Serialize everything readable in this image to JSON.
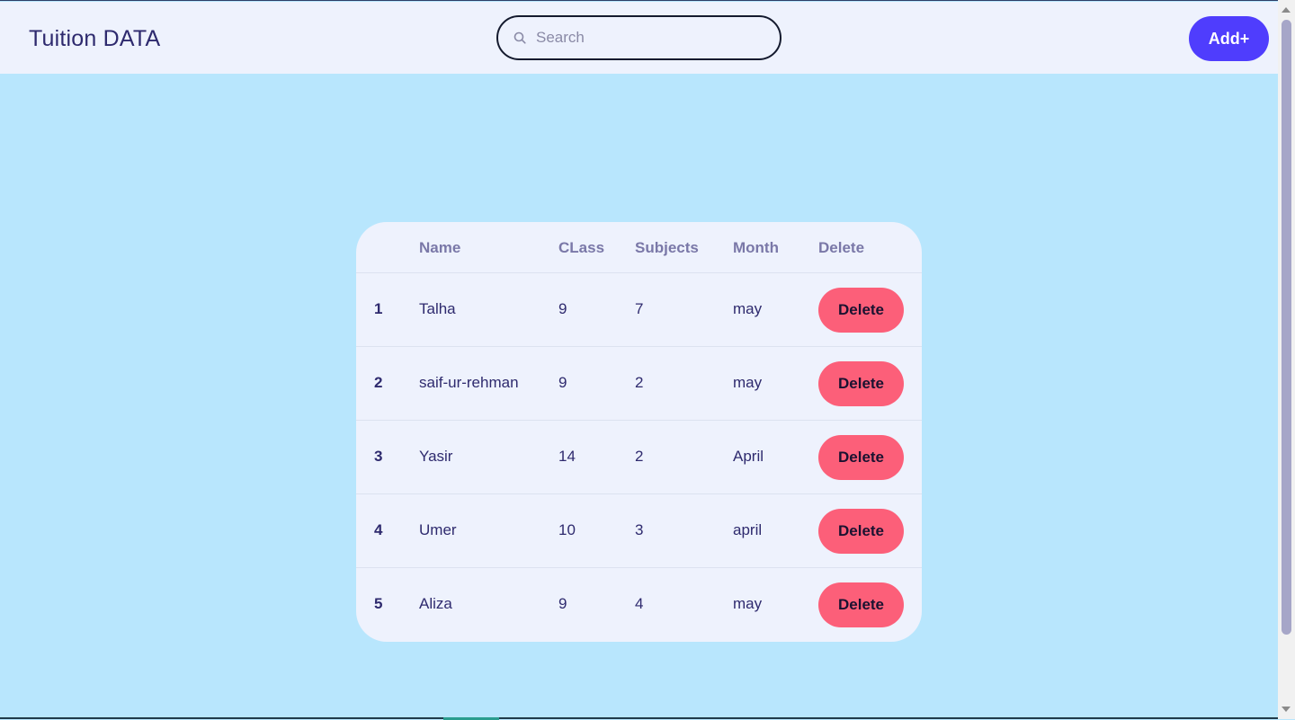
{
  "header": {
    "brand": "Tuition DATA",
    "search_placeholder": "Search",
    "add_label": "Add+"
  },
  "table": {
    "columns": [
      "Name",
      "CLass",
      "Subjects",
      "Month",
      "Delete"
    ],
    "rows": [
      {
        "idx": "1",
        "name": "Talha",
        "class": "9",
        "subjects": "7",
        "month": "may",
        "action": "Delete"
      },
      {
        "idx": "2",
        "name": "saif-ur-rehman",
        "class": "9",
        "subjects": "2",
        "month": "may",
        "action": "Delete"
      },
      {
        "idx": "3",
        "name": "Yasir",
        "class": "14",
        "subjects": "2",
        "month": "April",
        "action": "Delete"
      },
      {
        "idx": "4",
        "name": "Umer",
        "class": "10",
        "subjects": "3",
        "month": "april",
        "action": "Delete"
      },
      {
        "idx": "5",
        "name": "Aliza",
        "class": "9",
        "subjects": "4",
        "month": "may",
        "action": "Delete"
      }
    ]
  },
  "colors": {
    "background": "#b8e6fd",
    "surface": "#eef2fd",
    "primary": "#4f3dfd",
    "danger": "#fc5f79",
    "text": "#2e2a6e",
    "muted": "#7a78a8"
  },
  "icons": {
    "search": "search-icon"
  }
}
